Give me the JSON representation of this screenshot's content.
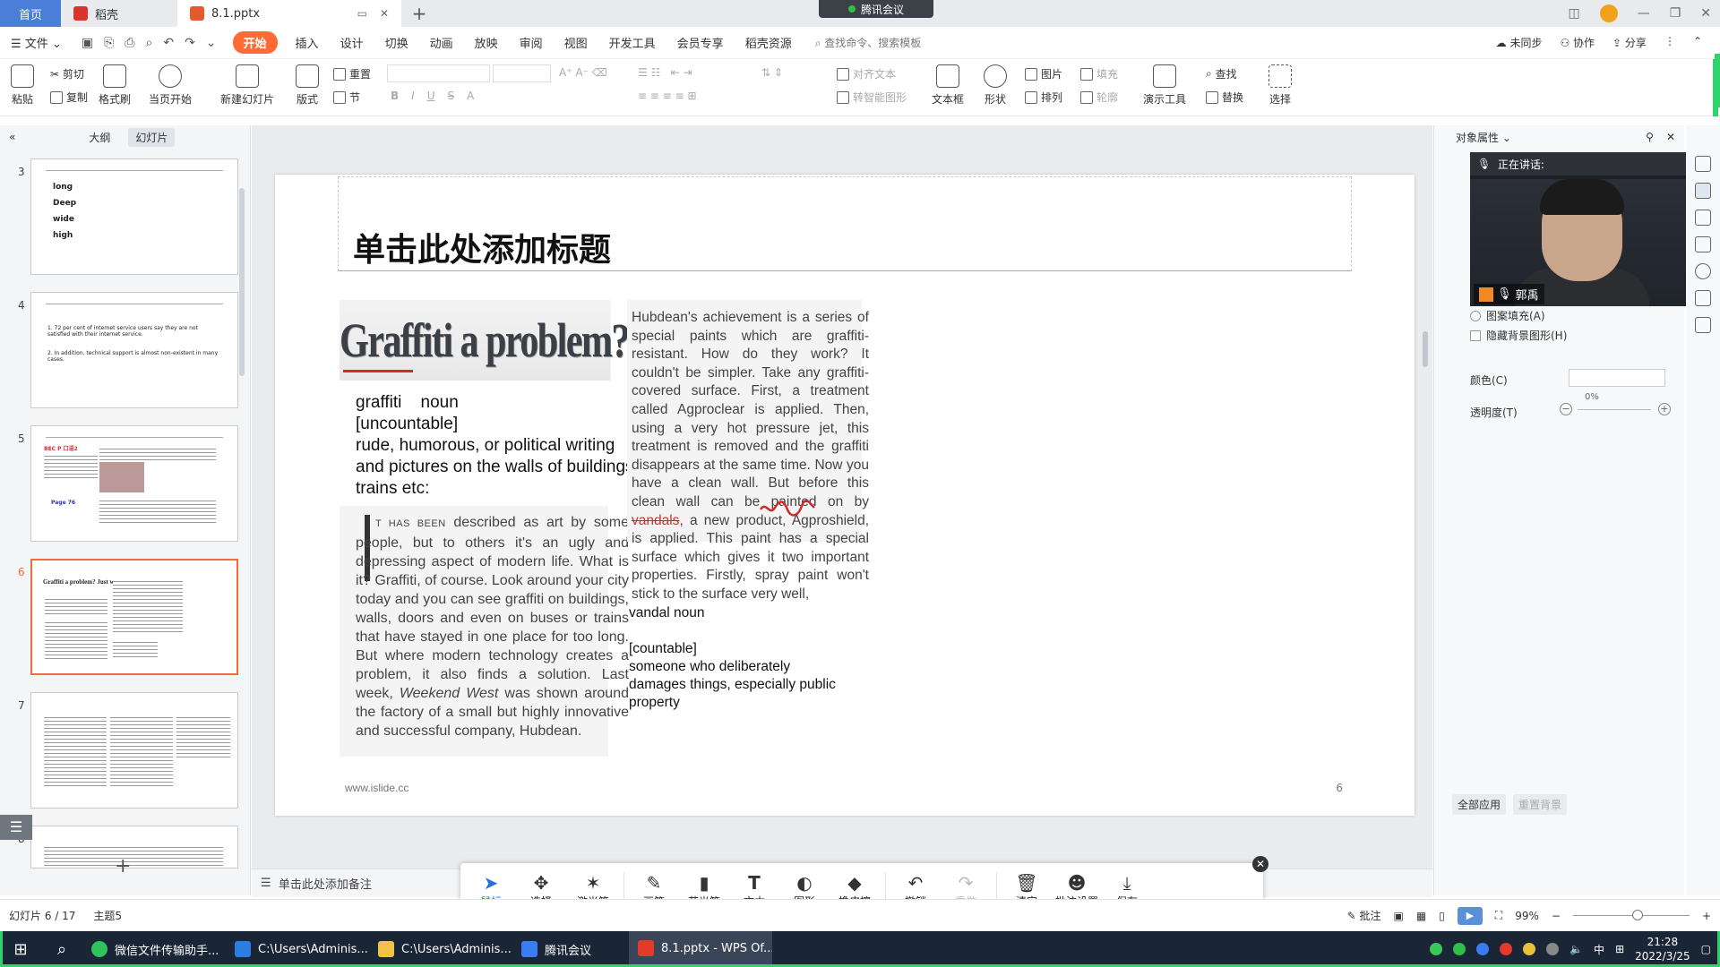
{
  "titlebar": {
    "tabs": [
      "首页",
      "稻壳",
      "8.1.pptx"
    ],
    "meeting": "腾讯会议"
  },
  "menubar": {
    "file": "文件",
    "items": [
      "开始",
      "插入",
      "设计",
      "切换",
      "动画",
      "放映",
      "审阅",
      "视图",
      "开发工具",
      "会员专享",
      "稻壳资源"
    ],
    "search": "查找命令、搜索模板",
    "right": [
      "未同步",
      "协作",
      "分享"
    ]
  },
  "ribbon": {
    "paste": "粘贴",
    "cut": "剪切",
    "copy": "复制",
    "format_painter": "格式刷",
    "from_current": "当页开始",
    "new_slide": "新建幻灯片",
    "layout": "版式",
    "reset": "重置",
    "section": "节",
    "text_box": "文本框",
    "shape": "形状",
    "picture": "图片",
    "fill": "填充",
    "arrange": "排列",
    "outline": "轮廓",
    "presentation_tools": "演示工具",
    "find": "查找",
    "replace": "替换",
    "select": "选择",
    "align_text": "对齐文本",
    "convert_smartart": "转智能图形",
    "bold": "B",
    "italic": "I",
    "underline": "U",
    "strike": "S",
    "font_color": "A"
  },
  "leftpanel": {
    "tab_outline": "大纲",
    "tab_slides": "幻灯片",
    "thumbs": [
      {
        "num": "3",
        "lines": [
          "long",
          "Deep",
          "wide",
          "high"
        ]
      },
      {
        "num": "4",
        "lines": [
          "1. 72 per cent of internet service users say they are not satisfied with their internet service.",
          "2. In addition, technical support is almost non-existent in many cases."
        ]
      },
      {
        "num": "5",
        "lines": [
          "BEC P 口语2",
          "Page 76"
        ]
      },
      {
        "num": "6",
        "lines": [
          "Graffiti a problem? Just wash it!"
        ]
      },
      {
        "num": "7",
        "lines": []
      },
      {
        "num": "8",
        "lines": []
      }
    ]
  },
  "slide": {
    "title": "单击此处添加标题",
    "headline": "Graffiti a problem? Just wash it!",
    "definition": [
      "graffiti    noun",
      "[uncountable]",
      "rude, humorous, or political writing",
      "and pictures on the walls of buildings,",
      "trains etc:"
    ],
    "article_left_lead": "T HAS BEEN",
    "article_left": "described as art by some people, but to others it's an ugly and depressing aspect of modern life. What is it? Graffiti, of course. Look around your city today and you can see graffiti on buildings, walls, doors and even on buses or trains that have stayed in one place for too long. But where modern technology creates a problem, it also finds a solution. Last week,",
    "article_left_italic": "Weekend West",
    "article_left_end": "was shown around the factory of a small but highly innovative and successful company, Hubdean.",
    "article_right_1": "Hubdean's achievement is a series of special paints which are graffiti-resistant. How do they work? It couldn't be simpler. Take any graffiti-covered surface. First, a treatment called Agproclear is applied. Then, using a very hot pressure jet, this treatment is removed and the graffiti disappears at the same time. Now you have a clean wall. But before this clean wall can be painted on by",
    "article_right_strike": "vandals",
    "article_right_2": ", a new product, Agproshield, is applied. This paint has a special surface which gives it two important properties. Firstly, spray paint won't stick to the surface very well,",
    "vandal": [
      "vandal  noun",
      "",
      "[countable]",
      "someone who deliberately",
      "damages things, especially public",
      "property"
    ],
    "footer_url": "www.islide.cc",
    "page": "6"
  },
  "notes": "单击此处添加备注",
  "rightpanel": {
    "title": "对象属性",
    "speaking": "正在讲话:",
    "speaker": "郭禹",
    "pattern_fill": "图案填充(A)",
    "hide_bg": "隐藏背景图形(H)",
    "color_label": "颜色(C)",
    "transparency_label": "透明度(T)",
    "transparency_value": "0%",
    "apply_all": "全部应用",
    "reset_bg": "重置背景"
  },
  "anno_tools": [
    {
      "label": "鼠标",
      "icon": "➤",
      "name": "mouse"
    },
    {
      "label": "选择",
      "icon": "✥",
      "name": "select"
    },
    {
      "label": "激光笔",
      "icon": "✶",
      "name": "laser"
    },
    {
      "label": "画笔",
      "icon": "✎",
      "name": "pen"
    },
    {
      "label": "荧光笔",
      "icon": "▮",
      "name": "highlighter"
    },
    {
      "label": "文本",
      "icon": "T",
      "name": "text"
    },
    {
      "label": "图形",
      "icon": "◐",
      "name": "shape"
    },
    {
      "label": "橡皮擦",
      "icon": "◆",
      "name": "eraser"
    },
    {
      "label": "撤销",
      "icon": "↶",
      "name": "undo"
    },
    {
      "label": "重做",
      "icon": "↷",
      "name": "redo"
    },
    {
      "label": "清空",
      "icon": "🗑",
      "name": "clear"
    },
    {
      "label": "批注设置",
      "icon": "☻",
      "name": "settings"
    },
    {
      "label": "保存",
      "icon": "⤓",
      "name": "save"
    }
  ],
  "statusbar": {
    "slide_info": "幻灯片 6 / 17",
    "theme": "主题5",
    "comment": "批注",
    "zoom": "99%"
  },
  "taskbar": {
    "items": [
      "微信文件传输助手...",
      "C:\\Users\\Adminis...",
      "C:\\Users\\Adminis...",
      "腾讯会议",
      "8.1.pptx - WPS Of..."
    ],
    "time": "21:28",
    "date": "2022/3/25",
    "ime": "中"
  }
}
